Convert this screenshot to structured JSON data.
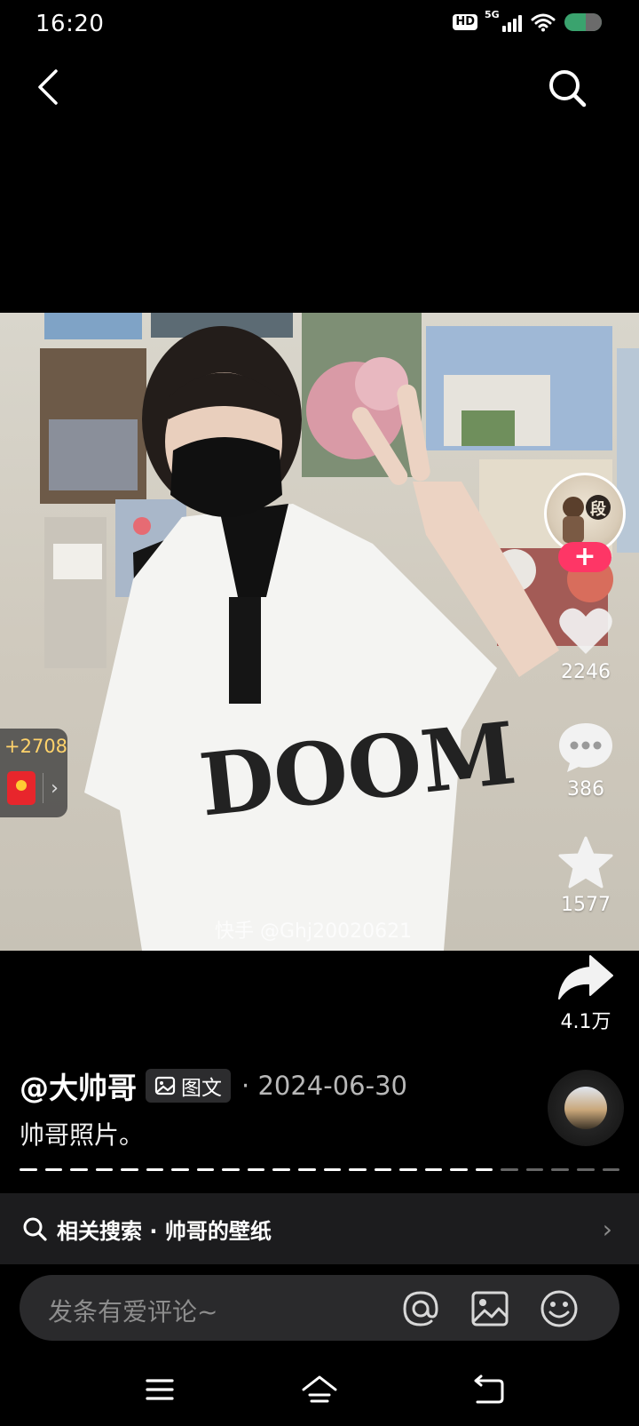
{
  "status_bar": {
    "time": "16:20",
    "hd_label": "HD",
    "network_label": "5G",
    "icons": [
      "hd-icon",
      "signal-5g-icon",
      "wifi-icon",
      "battery-icon"
    ]
  },
  "nav": {
    "icons": [
      "back-arrow-icon",
      "search-icon"
    ]
  },
  "photo": {
    "watermark": "快手 @Ghj20020621",
    "shirt_print": "DOOM"
  },
  "actions": {
    "avatar_badge": "段",
    "follow_label": "+",
    "like_count": "2246",
    "comment_count": "386",
    "favorite_count": "1577",
    "share_count": "4.1万",
    "icons": [
      "heart-icon",
      "comment-bubble-icon",
      "star-icon",
      "share-arrow-icon"
    ]
  },
  "red_packet": {
    "count": "+2708",
    "chevron": "›"
  },
  "post": {
    "author": "@大帅哥",
    "type_label": "图文",
    "separator": "·",
    "date": "2024-06-30",
    "description": "帅哥照片。",
    "progress_total": 24,
    "progress_filled": 19
  },
  "related_search": {
    "label": "相关搜索 · 帅哥的壁纸",
    "chevron": "›"
  },
  "comment_bar": {
    "placeholder": "发条有爱评论~",
    "icons": [
      "at-mention-icon",
      "image-picker-icon",
      "emoji-icon"
    ]
  },
  "system_nav": {
    "icons": [
      "menu-icon",
      "home-icon",
      "return-icon"
    ]
  },
  "colors": {
    "follow": "#fe3666",
    "red_packet_text": "#ffd36b",
    "panel": "#1c1c1e",
    "input": "#2a2a2c"
  }
}
